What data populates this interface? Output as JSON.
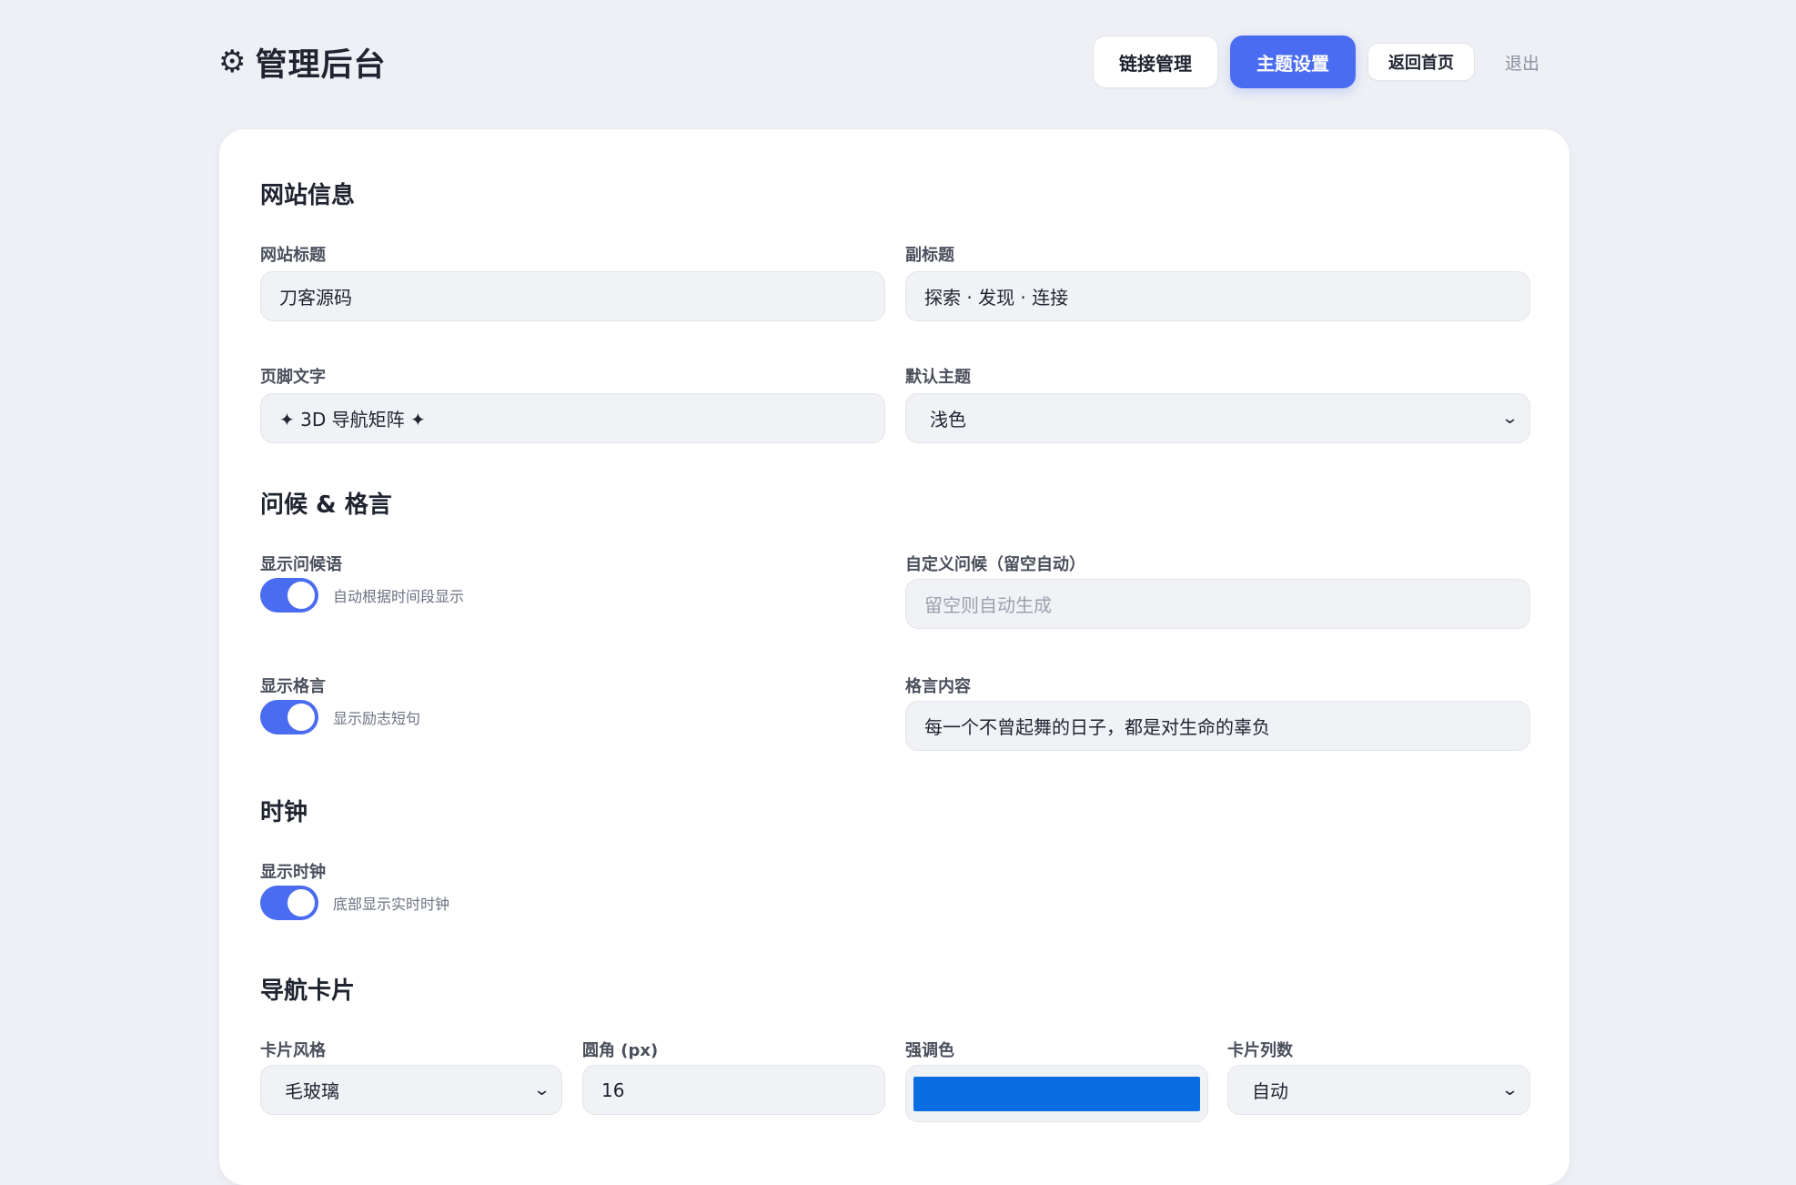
{
  "header": {
    "title": "管理后台",
    "gear_icon": "⚙",
    "nav": {
      "links_label": "链接管理",
      "theme_label": "主题设置",
      "home_label": "返回首页",
      "logout_label": "退出"
    }
  },
  "site_info": {
    "section_title": "网站信息",
    "site_title_label": "网站标题",
    "site_title_value": "刀客源码",
    "subtitle_label": "副标题",
    "subtitle_value": "探索 · 发现 · 连接",
    "footer_label": "页脚文字",
    "footer_value": "✦ 3D 导航矩阵 ✦",
    "default_theme_label": "默认主题",
    "default_theme_value": "浅色"
  },
  "greeting": {
    "section_title": "问候 & 格言",
    "show_greeting_label": "显示问候语",
    "show_greeting_hint": "自动根据时间段显示",
    "show_greeting_on": true,
    "custom_greeting_label": "自定义问候（留空自动）",
    "custom_greeting_placeholder": "留空则自动生成",
    "show_motto_label": "显示格言",
    "show_motto_hint": "显示励志短句",
    "show_motto_on": true,
    "motto_label": "格言内容",
    "motto_value": "每一个不曾起舞的日子，都是对生命的辜负"
  },
  "clock": {
    "section_title": "时钟",
    "show_clock_label": "显示时钟",
    "show_clock_hint": "底部显示实时时钟",
    "show_clock_on": true
  },
  "nav_cards": {
    "section_title": "导航卡片",
    "card_style_label": "卡片风格",
    "card_style_value": "毛玻璃",
    "radius_label": "圆角 (px)",
    "radius_value": "16",
    "accent_label": "强调色",
    "accent_color": "#0a6ee3",
    "columns_label": "卡片列数",
    "columns_value": "自动"
  },
  "colors": {
    "primary": "#4a6cf0",
    "background": "#eef0f5",
    "card": "#ffffff"
  }
}
